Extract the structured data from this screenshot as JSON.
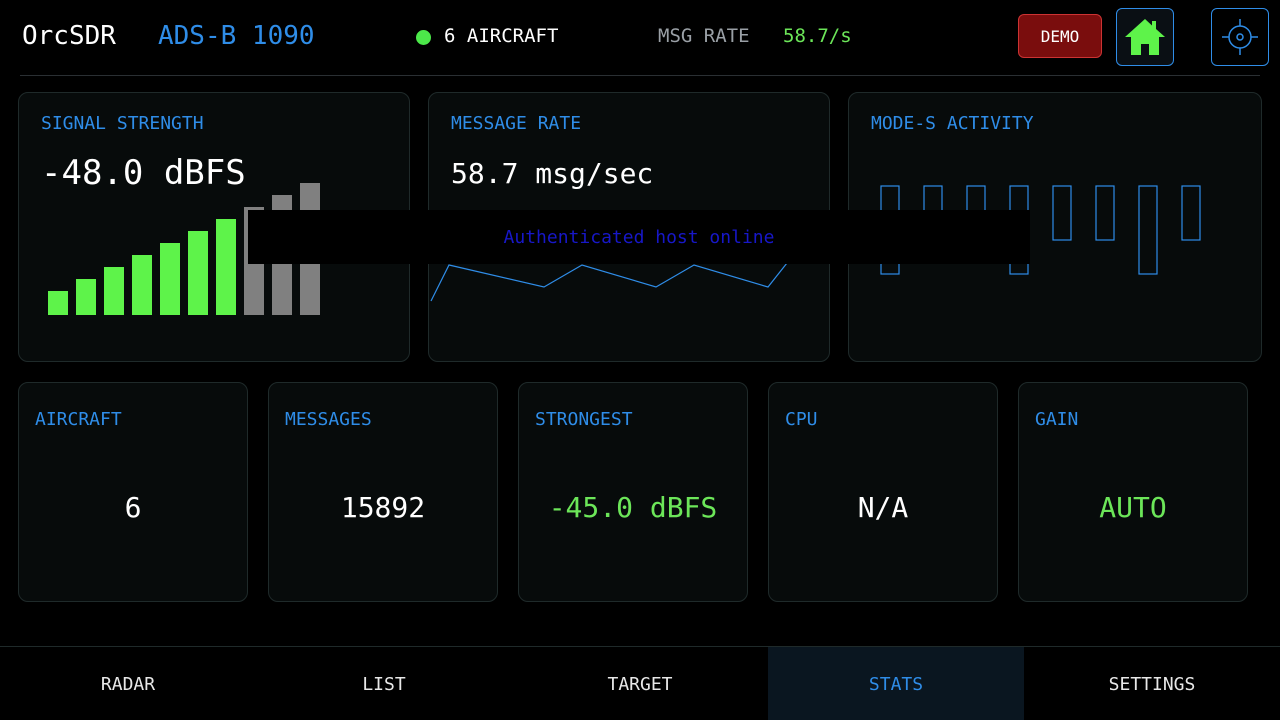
{
  "header": {
    "app_name": "OrcSDR",
    "mode": "ADS-B 1090",
    "aircraft_count": "6 AIRCRAFT",
    "msg_rate_label": "MSG RATE",
    "msg_rate_value": "58.7/s",
    "demo_label": "DEMO",
    "home_icon": "home-icon",
    "locate_icon": "crosshair-icon"
  },
  "signal": {
    "title": "SIGNAL STRENGTH",
    "value": "-48.0 dBFS",
    "bars_total": 10,
    "bars_active": 7
  },
  "rate": {
    "title": "MESSAGE RATE",
    "value": "58.7 msg/sec"
  },
  "activity": {
    "title": "MODE-S ACTIVITY"
  },
  "toast": {
    "text": "Authenticated host online"
  },
  "stats": [
    {
      "title": "AIRCRAFT",
      "value": "6"
    },
    {
      "title": "MESSAGES",
      "value": "15892"
    },
    {
      "title": "STRONGEST",
      "value": "-45.0 dBFS"
    },
    {
      "title": "CPU",
      "value": "N/A"
    },
    {
      "title": "GAIN",
      "value": "AUTO"
    }
  ],
  "nav": {
    "tabs": [
      "RADAR",
      "LIST",
      "TARGET",
      "STATS",
      "SETTINGS"
    ],
    "active": "STATS"
  },
  "colors": {
    "accent": "#2f8de8",
    "green": "#6ce659",
    "demo_bg": "#7a0d0d",
    "bar_active": "#5ef34a",
    "bar_inactive": "#808080",
    "toast_text": "#1717c8"
  }
}
